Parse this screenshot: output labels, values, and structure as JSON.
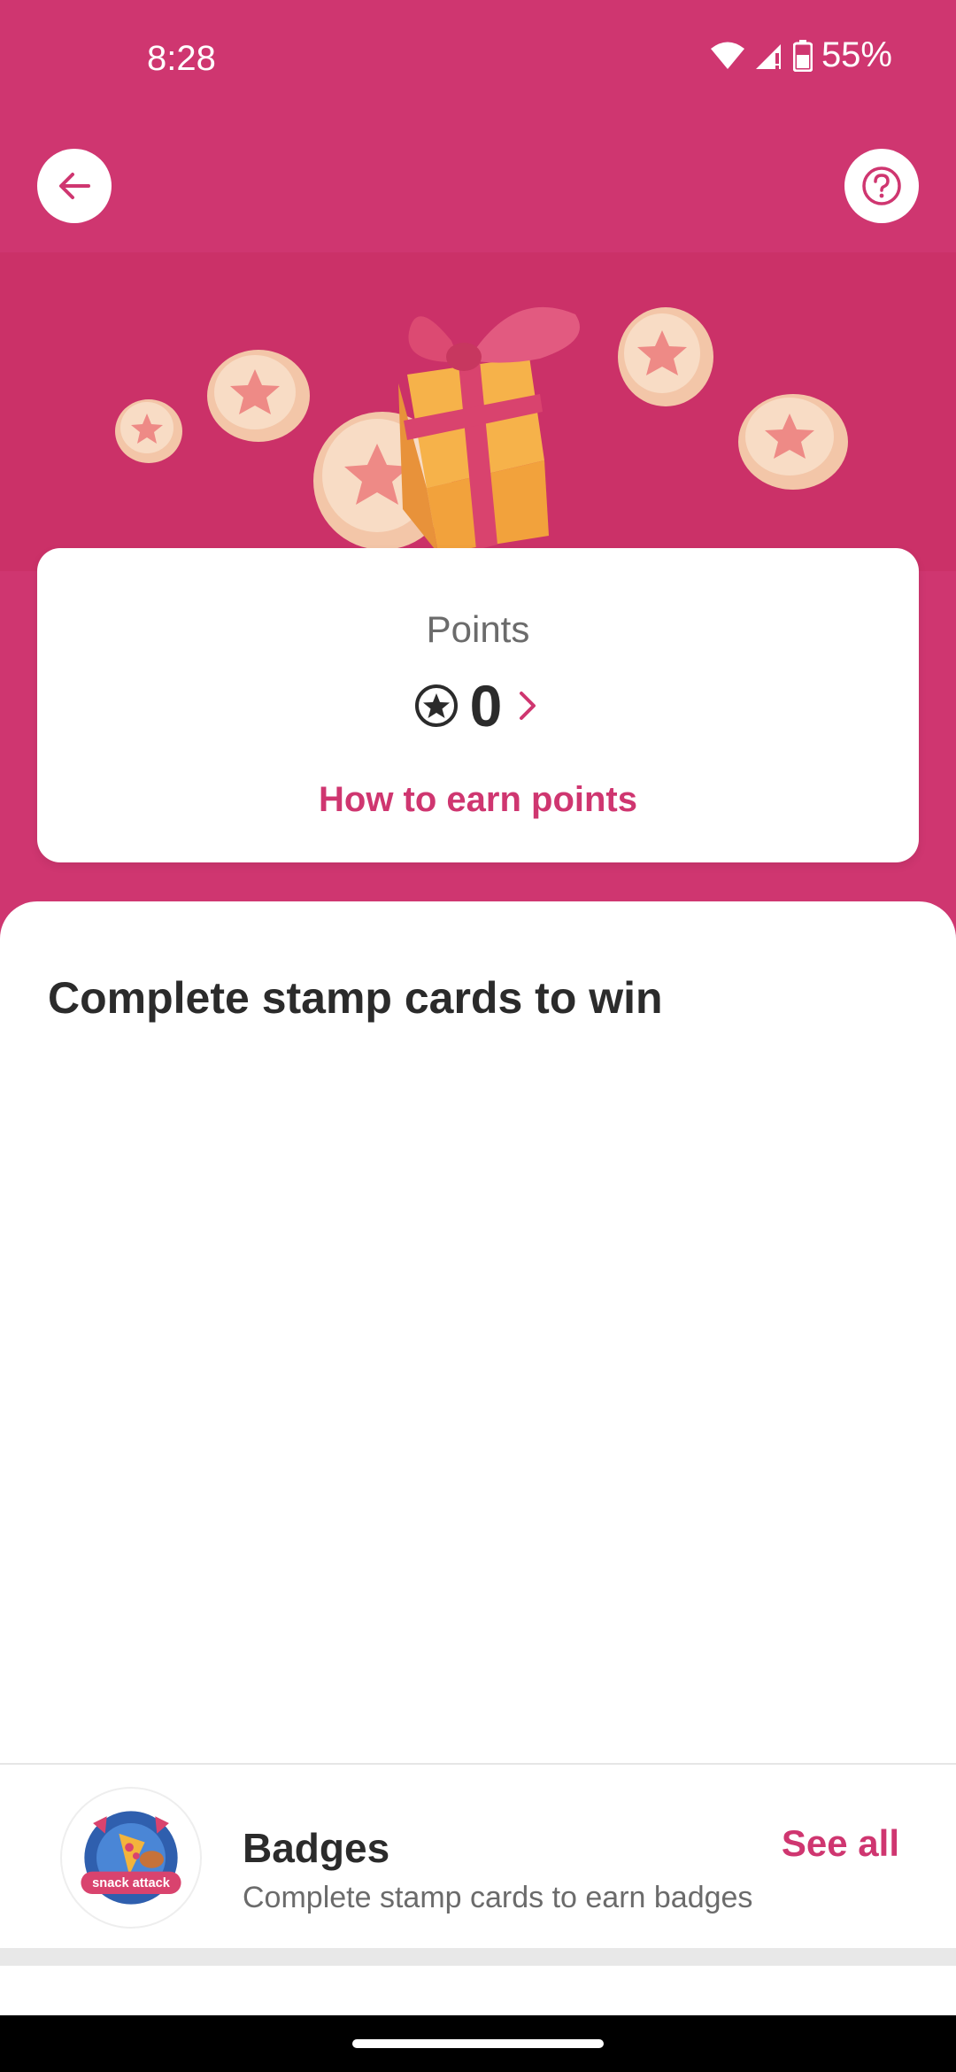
{
  "status_bar": {
    "time": "8:28",
    "battery_percent": "55%",
    "icons": [
      "wifi-icon",
      "cell-signal-icon",
      "battery-icon"
    ]
  },
  "header": {
    "back_icon": "arrow-left-icon",
    "help_icon": "question-circle-icon",
    "hero_illustration": "gift-and-coins"
  },
  "points_card": {
    "label": "Points",
    "value": "0",
    "star_icon": "star-circle-icon",
    "chevron_icon": "chevron-right-icon",
    "earn_link": "How to earn points"
  },
  "stamp_section": {
    "title": "Complete stamp cards to win"
  },
  "badges": {
    "title": "Badges",
    "subtitle": "Complete stamp cards to earn badges",
    "see_all": "See all",
    "badge_label": "snack attack"
  },
  "colors": {
    "brand": "#cf3670",
    "text_dark": "#2b2b2b",
    "text_muted": "#6b6b6b"
  }
}
